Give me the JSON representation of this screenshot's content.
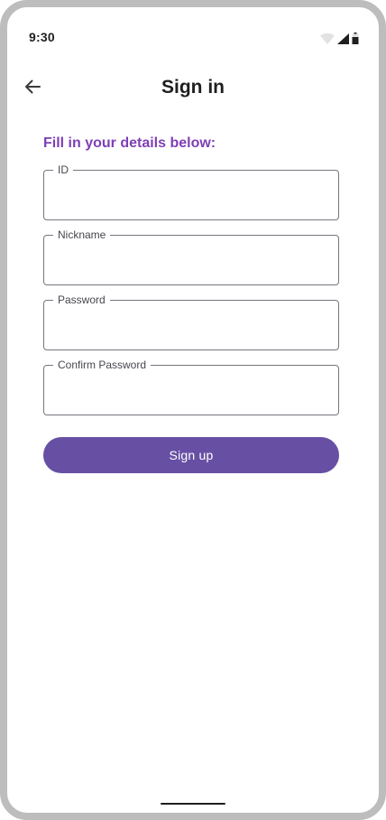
{
  "status_bar": {
    "time": "9:30",
    "icons": [
      "wifi-icon",
      "cellular-signal-icon",
      "battery-icon"
    ]
  },
  "app_bar": {
    "back_icon": "arrow-back-icon",
    "title": "Sign in"
  },
  "form": {
    "instructions": "Fill in your details below:",
    "fields": [
      {
        "label": "ID",
        "value": "",
        "type": "text"
      },
      {
        "label": "Nickname",
        "value": "",
        "type": "text"
      },
      {
        "label": "Password",
        "value": "",
        "type": "password"
      },
      {
        "label": "Confirm Password",
        "value": "",
        "type": "password"
      }
    ],
    "submit_label": "Sign up"
  },
  "colors": {
    "accent": "#6750a4",
    "instructions_text": "#7e3fb5",
    "outline": "#79747e",
    "frame": "#bdbdbd"
  }
}
